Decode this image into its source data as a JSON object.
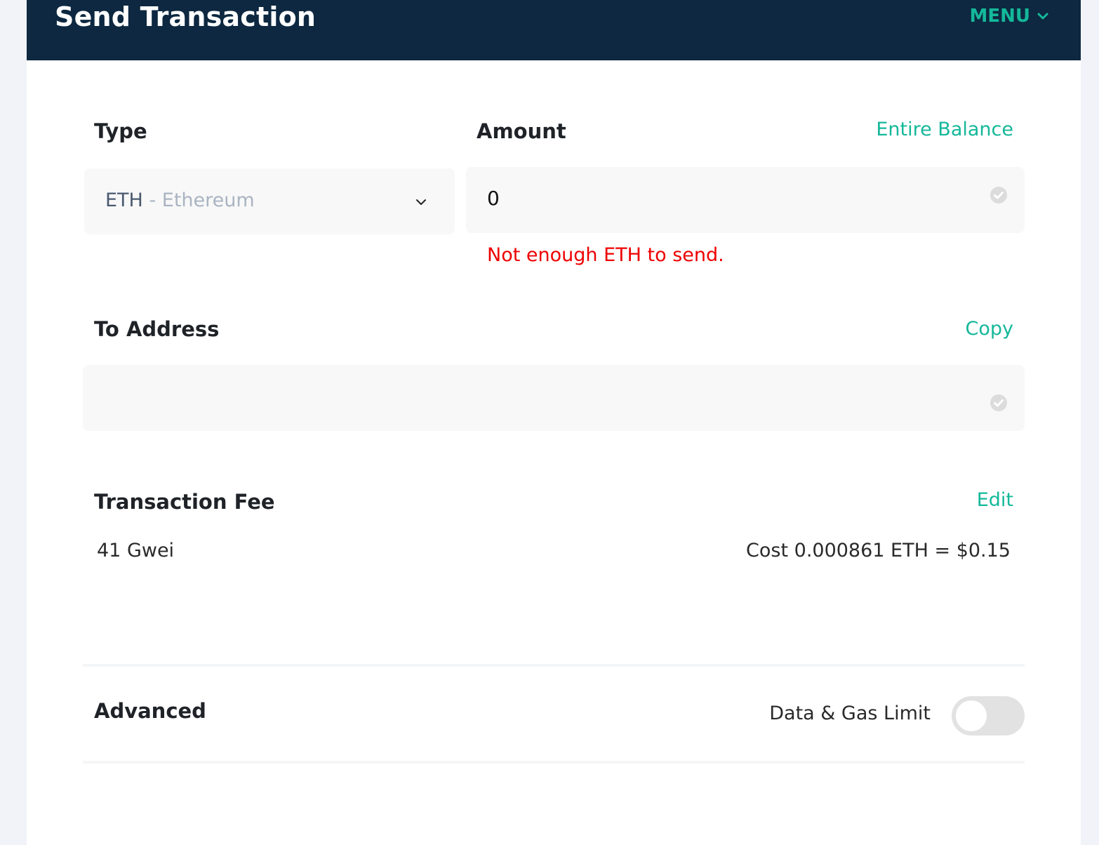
{
  "header": {
    "title": "Send Transaction",
    "menu_label": "MENU",
    "menu_icon": "chevron-down-icon"
  },
  "type_section": {
    "label": "Type",
    "selected_code": "ETH",
    "selected_name": " - Ethereum",
    "dropdown_icon": "chevron-down-icon"
  },
  "amount_section": {
    "label": "Amount",
    "entire_balance_label": "Entire Balance",
    "value": "0",
    "validation_icon": "check-circle-icon",
    "error": "Not enough ETH to send."
  },
  "address_section": {
    "label": "To Address",
    "copy_label": "Copy",
    "value": "",
    "validation_icon": "check-circle-icon"
  },
  "fee_section": {
    "label": "Transaction Fee",
    "edit_label": "Edit",
    "gas_price": "41 Gwei",
    "cost": "Cost 0.000861 ETH = $0.15"
  },
  "advanced_section": {
    "label": "Advanced",
    "toggle_label": "Data & Gas Limit",
    "toggle_on": false
  },
  "colors": {
    "header_bg": "#0d2840",
    "accent": "#14b89a",
    "error": "#ee0000",
    "page_bg": "#f1f3f8"
  }
}
